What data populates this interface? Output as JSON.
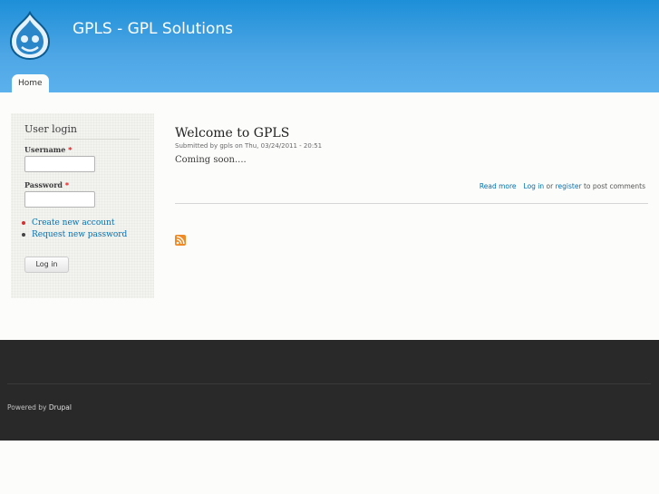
{
  "header": {
    "site_name": "GPLS - GPL Solutions",
    "logo_icon": "drupal-drop-icon",
    "colors": {
      "bar": "#3b9de2",
      "footer": "#292929",
      "link": "#0071b3"
    }
  },
  "tabs": [
    {
      "label": "Home"
    }
  ],
  "sidebar": {
    "block_title": "User login",
    "username_label": "Username",
    "password_label": "Password",
    "required_mark": "*",
    "links": [
      {
        "label": "Create new account",
        "bullet_color": "#d03030"
      },
      {
        "label": "Request new password",
        "bullet_color": "#444444"
      }
    ],
    "login_button": "Log in"
  },
  "node": {
    "title": "Welcome to GPLS",
    "submitted": "Submitted by gpls on Thu, 03/24/2011 - 20:51",
    "body": "Coming soon....",
    "read_more": "Read more",
    "log_in": "Log in",
    "or": "or",
    "register": "register",
    "post_comments": "to post comments",
    "feed_icon": "rss-feed-icon"
  },
  "footer": {
    "powered_by": "Powered by",
    "drupal": "Drupal"
  }
}
